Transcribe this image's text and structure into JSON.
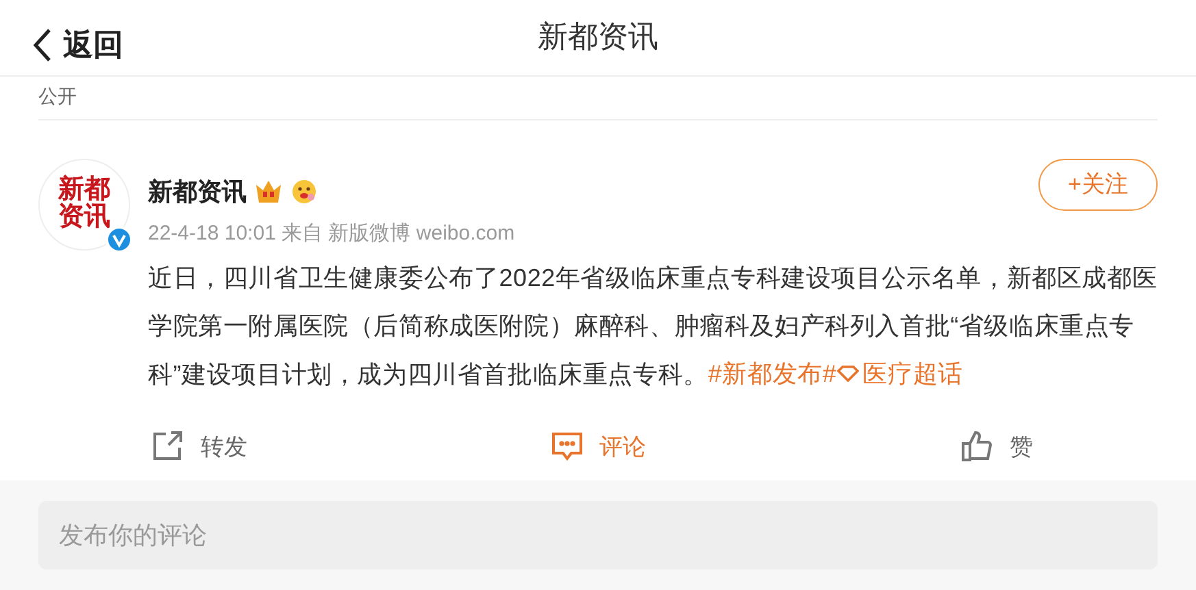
{
  "header": {
    "back_label": "返回",
    "title": "新都资讯"
  },
  "visibility": "公开",
  "post": {
    "avatar_text": "新都资讯",
    "verified": true,
    "author": "新都资讯",
    "meta": "22-4-18 10:01 来自 新版微博 weibo.com",
    "follow_label": "+关注",
    "body": "近日，四川省卫生健康委公布了2022年省级临床重点专科建设项目公示名单，新都区成都医学院第一附属医院（后简称成医附院）麻醉科、肿瘤科及妇产科列入首批“省级临床重点专科”建设项目计划，成为四川省首批临床重点专科。",
    "hashtag": "#新都发布#",
    "topic": "医疗超话"
  },
  "actions": [
    {
      "kind": "repost",
      "label": "转发",
      "selected": false
    },
    {
      "kind": "comment",
      "label": "评论",
      "selected": true
    },
    {
      "kind": "like",
      "label": "赞",
      "selected": false
    }
  ],
  "comment_box": {
    "placeholder": "发布你的评论"
  }
}
